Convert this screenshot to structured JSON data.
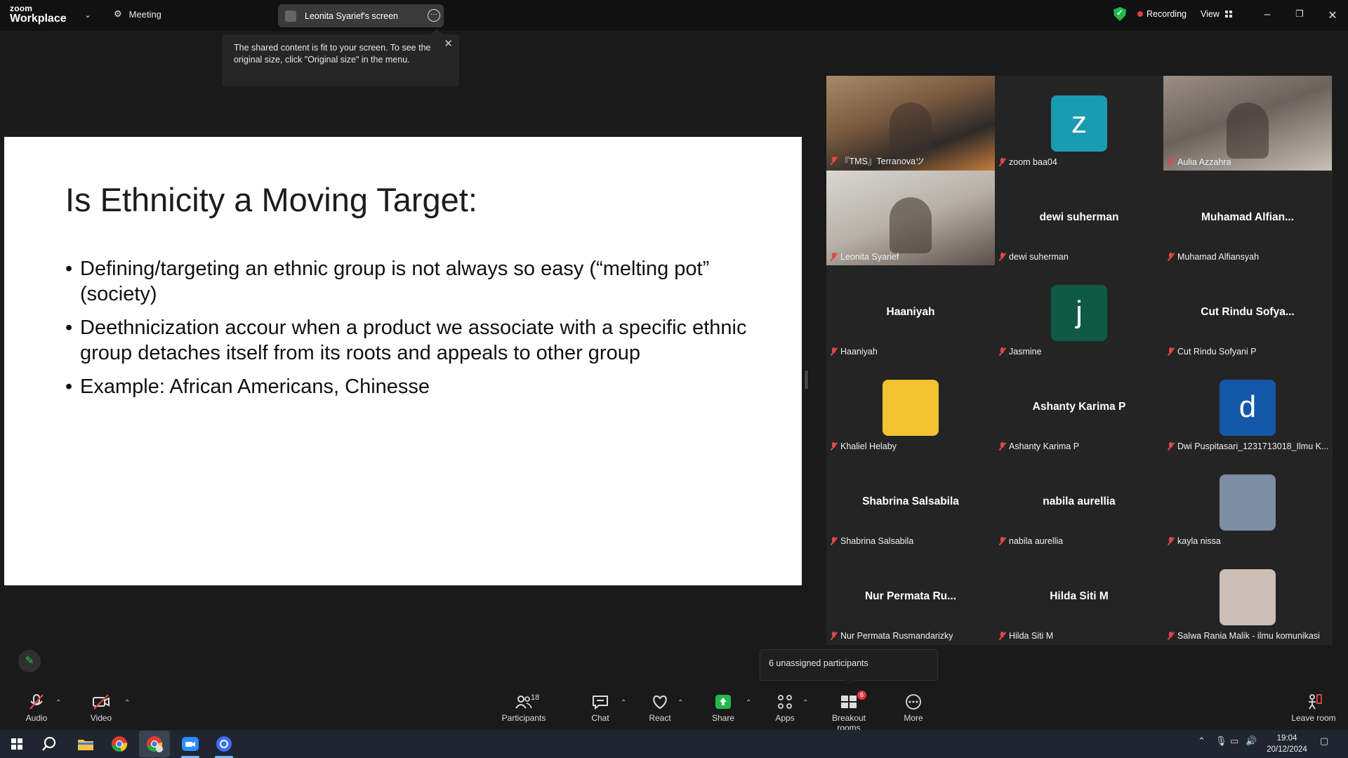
{
  "app": {
    "logo_line1": "zoom",
    "logo_line2": "Workplace"
  },
  "topbar": {
    "meeting_label": "Meeting",
    "screen_label": "Leonita Syarief's screen",
    "recording_label": "Recording",
    "view_label": "View"
  },
  "tooltip": {
    "text": "The shared content is fit to your screen. To see the original size, click \"Original size\" in the menu."
  },
  "slide": {
    "title": "Is Ethnicity a Moving Target:",
    "bullets": [
      "Defining/targeting an ethnic group is not always so easy (“melting pot” (society)",
      "Deethnicization accour when a product we associate with a specific ethnic group detaches itself from its roots and appeals to other group",
      "Example: African Americans, Chinesse"
    ]
  },
  "gallery": {
    "tiles": [
      {
        "label": "『TMS』Terranovaツ",
        "kind": "video"
      },
      {
        "label": "zoom baa04",
        "kind": "avatar",
        "letter": "z",
        "color": "#1a9bb0"
      },
      {
        "label": "Aulia Azzahra",
        "kind": "video"
      },
      {
        "label": "Leonita Syarief",
        "kind": "video",
        "active": true
      },
      {
        "label": "dewi suherman",
        "kind": "name",
        "name": "dewi suherman"
      },
      {
        "label": "Muhamad Alfiansyah",
        "kind": "name",
        "name": "Muhamad  Alfian..."
      },
      {
        "label": "Haaniyah",
        "kind": "name",
        "name": "Haaniyah"
      },
      {
        "label": "Jasmine",
        "kind": "avatar",
        "letter": "j",
        "color": "#0f5a45"
      },
      {
        "label": "Cut Rindu Sofyani P",
        "kind": "name",
        "name": "Cut Rindu Sofya..."
      },
      {
        "label": "Khaliel Helaby",
        "kind": "photo",
        "color": "#f2c230"
      },
      {
        "label": "Ashanty Karima P",
        "kind": "name",
        "name": "Ashanty Karima P"
      },
      {
        "label": "Dwi Puspitasari_1231713018_Ilmu K...",
        "kind": "avatar",
        "letter": "d",
        "color": "#1557a8"
      },
      {
        "label": "Shabrina Salsabila",
        "kind": "name",
        "name": "Shabrina Salsabila"
      },
      {
        "label": "nabila aurellia",
        "kind": "name",
        "name": "nabila aurellia"
      },
      {
        "label": "kayla nissa",
        "kind": "photo",
        "color": "#7d8ea3"
      },
      {
        "label": "Nur Permata Rusmandarizky",
        "kind": "name",
        "name": "Nur Permata Ru..."
      },
      {
        "label": "Hilda Siti M",
        "kind": "name",
        "name": "Hilda Siti M"
      },
      {
        "label": "Salwa Rania Malik - ilmu komunikasi",
        "kind": "photo",
        "color": "#cdbfb5"
      }
    ]
  },
  "unassigned": "6 unassigned participants",
  "toolbar": {
    "audio": "Audio",
    "video": "Video",
    "participants": "Participants",
    "participants_count": "18",
    "chat": "Chat",
    "react": "React",
    "share": "Share",
    "apps": "Apps",
    "breakout": "Breakout rooms",
    "breakout_badge": "6",
    "more": "More",
    "leave": "Leave room"
  },
  "taskbar": {
    "time": "19:04",
    "date": "20/12/2024"
  },
  "colors": {
    "accent_green": "#3fd37a",
    "mic_off_red": "#e04848",
    "share_green": "#1fba4b"
  }
}
